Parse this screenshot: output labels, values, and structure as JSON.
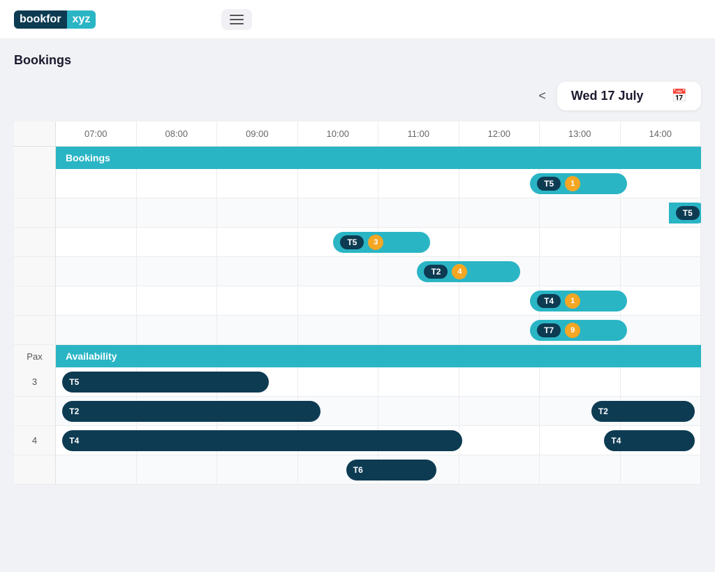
{
  "header": {
    "logo_bookfor": "bookfor",
    "logo_xyz": "xyz",
    "menu_label": "Menu"
  },
  "page": {
    "title": "Bookings"
  },
  "date_nav": {
    "prev_label": "<",
    "date": "Wed 17 July",
    "next_label": ">",
    "calendar_icon": "📅"
  },
  "time_slots": [
    "07:00",
    "08:00",
    "09:00",
    "10:00",
    "11:00",
    "12:00",
    "13:00",
    "14:00"
  ],
  "sections": {
    "bookings_label": "Bookings",
    "availability_label": "Availability"
  },
  "bookings": [
    {
      "id": "row1",
      "label": "",
      "chips": [
        {
          "name": "T5",
          "badge": "1",
          "left_pct": 73.5,
          "width_pct": 15
        }
      ]
    },
    {
      "id": "row2",
      "label": "",
      "chips": [
        {
          "name": "T5",
          "badge": null,
          "left_pct": 95,
          "width_pct": 6,
          "partial": true
        }
      ]
    },
    {
      "id": "row3",
      "label": "",
      "chips": [
        {
          "name": "T5",
          "badge": "3",
          "left_pct": 43,
          "width_pct": 15
        }
      ]
    },
    {
      "id": "row4",
      "label": "",
      "chips": [
        {
          "name": "T2",
          "badge": "4",
          "left_pct": 56,
          "width_pct": 16
        }
      ]
    },
    {
      "id": "row5",
      "label": "",
      "chips": [
        {
          "name": "T4",
          "badge": "1",
          "left_pct": 73.5,
          "width_pct": 15
        }
      ]
    },
    {
      "id": "row6",
      "label": "",
      "chips": [
        {
          "name": "T7",
          "badge": "9",
          "left_pct": 73.5,
          "width_pct": 15
        }
      ]
    }
  ],
  "availability": [
    {
      "pax": "3",
      "bars": [
        {
          "name": "T5",
          "badge": null,
          "left_pct": 1,
          "width_pct": 32
        }
      ]
    },
    {
      "pax": "",
      "bars": [
        {
          "name": "T2",
          "badge": null,
          "left_pct": 1,
          "width_pct": 40
        },
        {
          "name": "T2",
          "badge": null,
          "left_pct": 83,
          "width_pct": 16
        }
      ]
    },
    {
      "pax": "4",
      "bars": [
        {
          "name": "T4",
          "badge": null,
          "left_pct": 1,
          "width_pct": 62
        },
        {
          "name": "T4",
          "badge": null,
          "left_pct": 85,
          "width_pct": 14
        }
      ]
    },
    {
      "pax": "",
      "bars": [
        {
          "name": "T6",
          "badge": null,
          "left_pct": 45,
          "width_pct": 14
        }
      ]
    }
  ]
}
